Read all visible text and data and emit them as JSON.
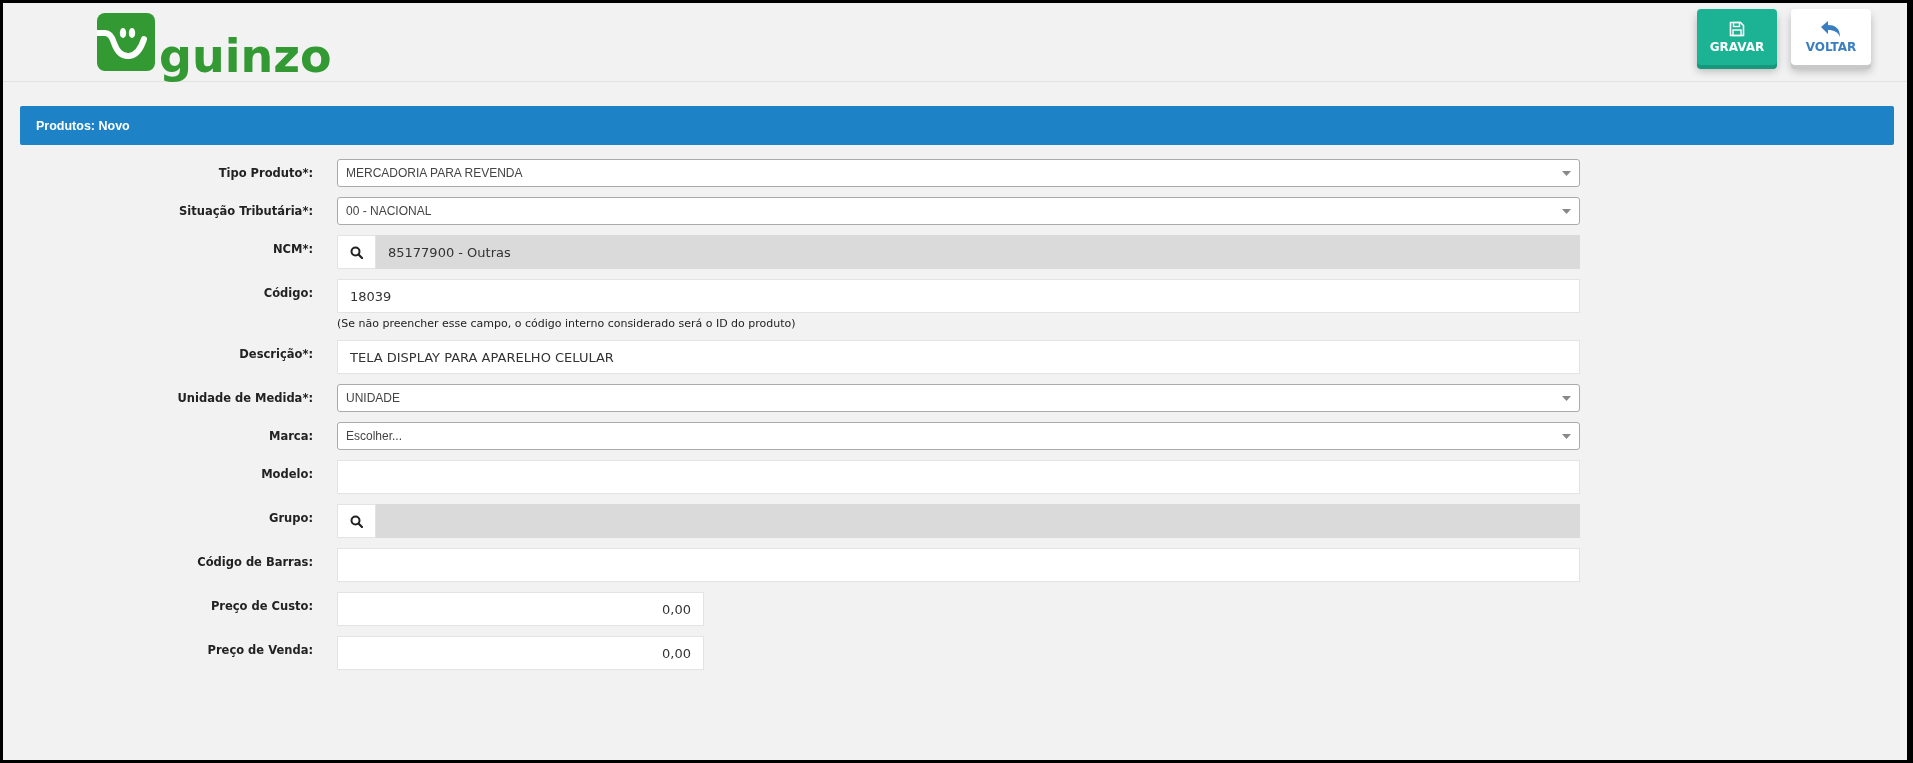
{
  "logo": {
    "text": "guinzo"
  },
  "buttons": [
    {
      "label": "GRAVAR",
      "kind": "primary"
    },
    {
      "label": "VOLTAR",
      "kind": "secondary"
    }
  ],
  "panel": {
    "title": "Produtos: Novo"
  },
  "fields": [
    {
      "label": "Tipo Produto*:",
      "kind": "select",
      "value": "MERCADORIA PARA REVENDA"
    },
    {
      "label": "Situação Tributária*:",
      "kind": "select",
      "value": "00 - NACIONAL"
    },
    {
      "label": "NCM*:",
      "kind": "lookup",
      "value": "85177900 - Outras"
    },
    {
      "label": "Código:",
      "kind": "text",
      "value": "18039",
      "hint": "(Se não preencher esse campo, o código interno considerado será o ID do produto)"
    },
    {
      "label": "Descrição*:",
      "kind": "text",
      "value": "TELA DISPLAY PARA APARELHO CELULAR"
    },
    {
      "label": "Unidade de Medida*:",
      "kind": "select",
      "value": "UNIDADE"
    },
    {
      "label": "Marca:",
      "kind": "select",
      "value": "Escolher..."
    },
    {
      "label": "Modelo:",
      "kind": "text"
    },
    {
      "label": "Grupo:",
      "kind": "lookup"
    },
    {
      "label": "Código de Barras:",
      "kind": "text"
    },
    {
      "label": "Preço de Custo:",
      "kind": "number",
      "value": "0,00"
    },
    {
      "label": "Preço de Venda:",
      "kind": "number",
      "value": "0,00"
    }
  ]
}
